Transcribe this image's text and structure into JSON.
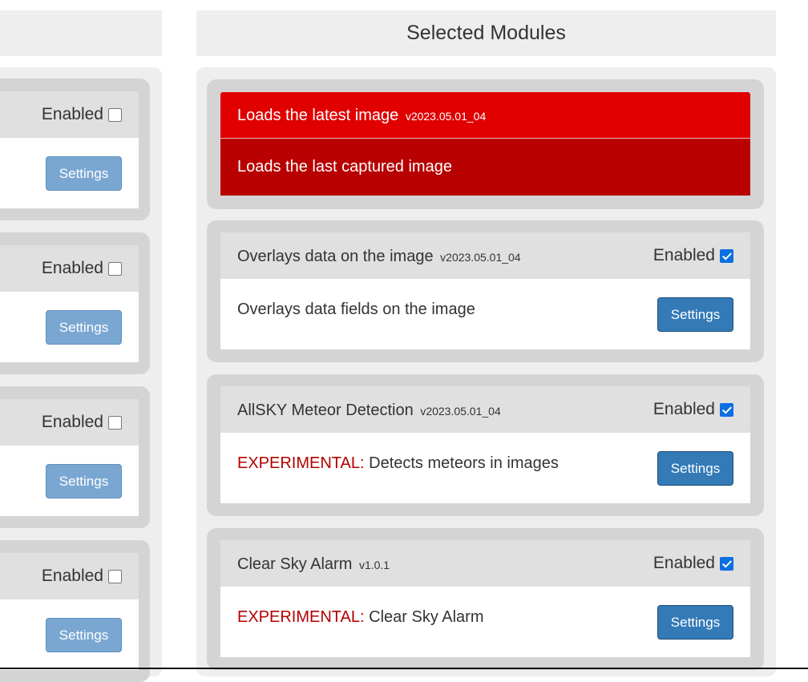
{
  "available_column": {
    "modules": [
      {
        "enabled_label": "Enabled",
        "enabled": false,
        "settings_label": "Settings"
      },
      {
        "enabled_label": "Enabled",
        "enabled": false,
        "settings_label": "Settings"
      },
      {
        "enabled_label": "Enabled",
        "enabled": false,
        "settings_label": "Settings"
      },
      {
        "enabled_label": "Enabled",
        "enabled": false,
        "settings_label": "Settings"
      }
    ]
  },
  "selected_column": {
    "header": "Selected Modules",
    "loader": {
      "title": "Loads the latest image",
      "version": "v2023.05.01_04",
      "description": "Loads the last captured image"
    },
    "modules": [
      {
        "title": "Overlays data on the image",
        "version": "v2023.05.01_04",
        "enabled_label": "Enabled",
        "enabled": true,
        "experimental_label": "",
        "description": "Overlays data fields on the image",
        "settings_label": "Settings"
      },
      {
        "title": "AllSKY Meteor Detection",
        "version": "v2023.05.01_04",
        "enabled_label": "Enabled",
        "enabled": true,
        "experimental_label": "EXPERIMENTAL:",
        "description": "Detects meteors in images",
        "settings_label": "Settings"
      },
      {
        "title": "Clear Sky Alarm",
        "version": "v1.0.1",
        "enabled_label": "Enabled",
        "enabled": true,
        "experimental_label": "EXPERIMENTAL:",
        "description": "Clear Sky Alarm",
        "settings_label": "Settings"
      }
    ]
  },
  "colors": {
    "loader_header": "#e00000",
    "loader_body": "#b80000",
    "experimental_text": "#b30000",
    "checkbox_checked": "#0b6fe2",
    "settings_button": "#337ab7"
  }
}
